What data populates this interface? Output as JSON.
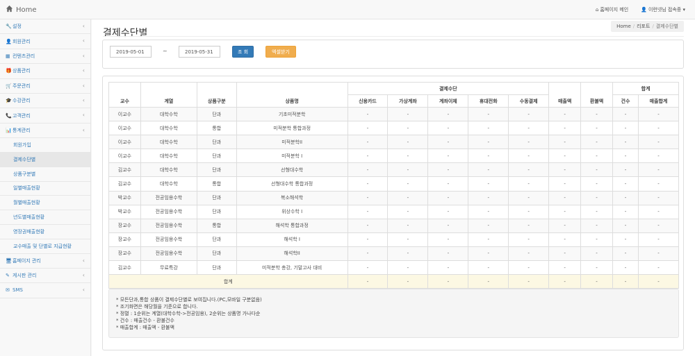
{
  "app": {
    "title": "Home"
  },
  "topnav": {
    "home_link": "홈페이지 메인",
    "user_menu": "이런넷님 접속중"
  },
  "sidebar": {
    "items": [
      {
        "label": "설정",
        "icon": "wrench-icon",
        "glyph": "🔧"
      },
      {
        "label": "회원관리",
        "icon": "user-icon",
        "glyph": "👤"
      },
      {
        "label": "컨텐츠관리",
        "icon": "film-icon",
        "glyph": "▦"
      },
      {
        "label": "상품관리",
        "icon": "gift-icon",
        "glyph": "🎁"
      },
      {
        "label": "주문관리",
        "icon": "cart-icon",
        "glyph": "🛒"
      },
      {
        "label": "수강관리",
        "icon": "graduation-cap-icon",
        "glyph": "🎓"
      },
      {
        "label": "고객관리",
        "icon": "phone-icon",
        "glyph": "📞"
      },
      {
        "label": "통계관리",
        "icon": "bar-chart-icon",
        "glyph": "📊"
      }
    ],
    "sub_items": [
      {
        "label": "회원가입"
      },
      {
        "label": "결제수단별"
      },
      {
        "label": "상품구분별"
      },
      {
        "label": "일별매출현황"
      },
      {
        "label": "월별매출현황"
      },
      {
        "label": "년도별매출현황"
      },
      {
        "label": "영장권매출현황"
      },
      {
        "label": "교수매출 및 단별로 지급현황"
      }
    ],
    "bottom_items": [
      {
        "label": "홈페이지 관리",
        "icon": "desktop-icon",
        "glyph": "🖥"
      },
      {
        "label": "게시판 관리",
        "icon": "edit-icon",
        "glyph": "✎"
      },
      {
        "label": "SMS",
        "icon": "envelope-icon",
        "glyph": "✉"
      }
    ]
  },
  "page": {
    "title": "결제수단별",
    "breadcrumb": [
      "Home",
      "리포트",
      "결제수단별"
    ]
  },
  "search": {
    "start_date": "2019-05-01",
    "end_date": "2019-05-31",
    "separator": "~",
    "search_button": "조 회",
    "excel_button": "엑셀받기"
  },
  "table": {
    "headers": {
      "professor": "교수",
      "category": "계열",
      "product_type": "상품구분",
      "product_name": "상품명",
      "payment_method": "결제수단",
      "credit_card": "신용카드",
      "virtual_account": "가상계좌",
      "bank_transfer": "계좌이체",
      "mobile": "휴대전화",
      "manual": "수동결제",
      "sales": "매출액",
      "refund": "환불액",
      "total": "합계",
      "count": "건수",
      "sales_total": "매출합계"
    },
    "rows": [
      [
        "이교수",
        "대학수학",
        "단과",
        "기초미적분학",
        "-",
        "-",
        "-",
        "-",
        "-",
        "-",
        "-",
        "-",
        "-"
      ],
      [
        "이교수",
        "대학수학",
        "통합",
        "미적분학 통합과정",
        "-",
        "-",
        "-",
        "-",
        "-",
        "-",
        "-",
        "-",
        "-"
      ],
      [
        "이교수",
        "대학수학",
        "단과",
        "미적분학II",
        "-",
        "-",
        "-",
        "-",
        "-",
        "-",
        "-",
        "-",
        "-"
      ],
      [
        "이교수",
        "대학수학",
        "단과",
        "미적분학 I",
        "-",
        "-",
        "-",
        "-",
        "-",
        "-",
        "-",
        "-",
        "-"
      ],
      [
        "김교수",
        "대학수학",
        "단과",
        "선형대수학",
        "-",
        "-",
        "-",
        "-",
        "-",
        "-",
        "-",
        "-",
        "-"
      ],
      [
        "김교수",
        "대학수학",
        "통합",
        "선형대수학 통합과정",
        "-",
        "-",
        "-",
        "-",
        "-",
        "-",
        "-",
        "-",
        "-"
      ],
      [
        "박교수",
        "전공임용수학",
        "단과",
        "복소해석학",
        "-",
        "-",
        "-",
        "-",
        "-",
        "-",
        "-",
        "-",
        "-"
      ],
      [
        "박교수",
        "전공임용수학",
        "단과",
        "위상수학 I",
        "-",
        "-",
        "-",
        "-",
        "-",
        "-",
        "-",
        "-",
        "-"
      ],
      [
        "장교수",
        "전공임용수학",
        "통합",
        "해석학 통합과정",
        "-",
        "-",
        "-",
        "-",
        "-",
        "-",
        "-",
        "-",
        "-"
      ],
      [
        "장교수",
        "전공임용수학",
        "단과",
        "해석학 I",
        "-",
        "-",
        "-",
        "-",
        "-",
        "-",
        "-",
        "-",
        "-"
      ],
      [
        "장교수",
        "전공임용수학",
        "단과",
        "해석학II",
        "-",
        "-",
        "-",
        "-",
        "-",
        "-",
        "-",
        "-",
        "-"
      ],
      [
        "김교수",
        "무료특강",
        "단과",
        "미적분학 총강, 기말고사 대비",
        "-",
        "-",
        "-",
        "-",
        "-",
        "-",
        "-",
        "-",
        "-"
      ]
    ],
    "total_row": [
      "합계",
      "-",
      "-",
      "-",
      "-",
      "-",
      "-",
      "-",
      "-",
      "-"
    ]
  },
  "notes": [
    "* 모든단과,통합 상품이 결제수단별로 보여집니다.(PC,모바일 구분없음)",
    "* 조기화면은 해당월을 기준으로 합니다.",
    "* 정렬 : 1순위는 계열(대학수학->전공임용), 2순위는 상품명 가나다순",
    "* 건수 : 매출건수 - 환불건수",
    "* 매출합계 : 매출액 - 환불액"
  ]
}
